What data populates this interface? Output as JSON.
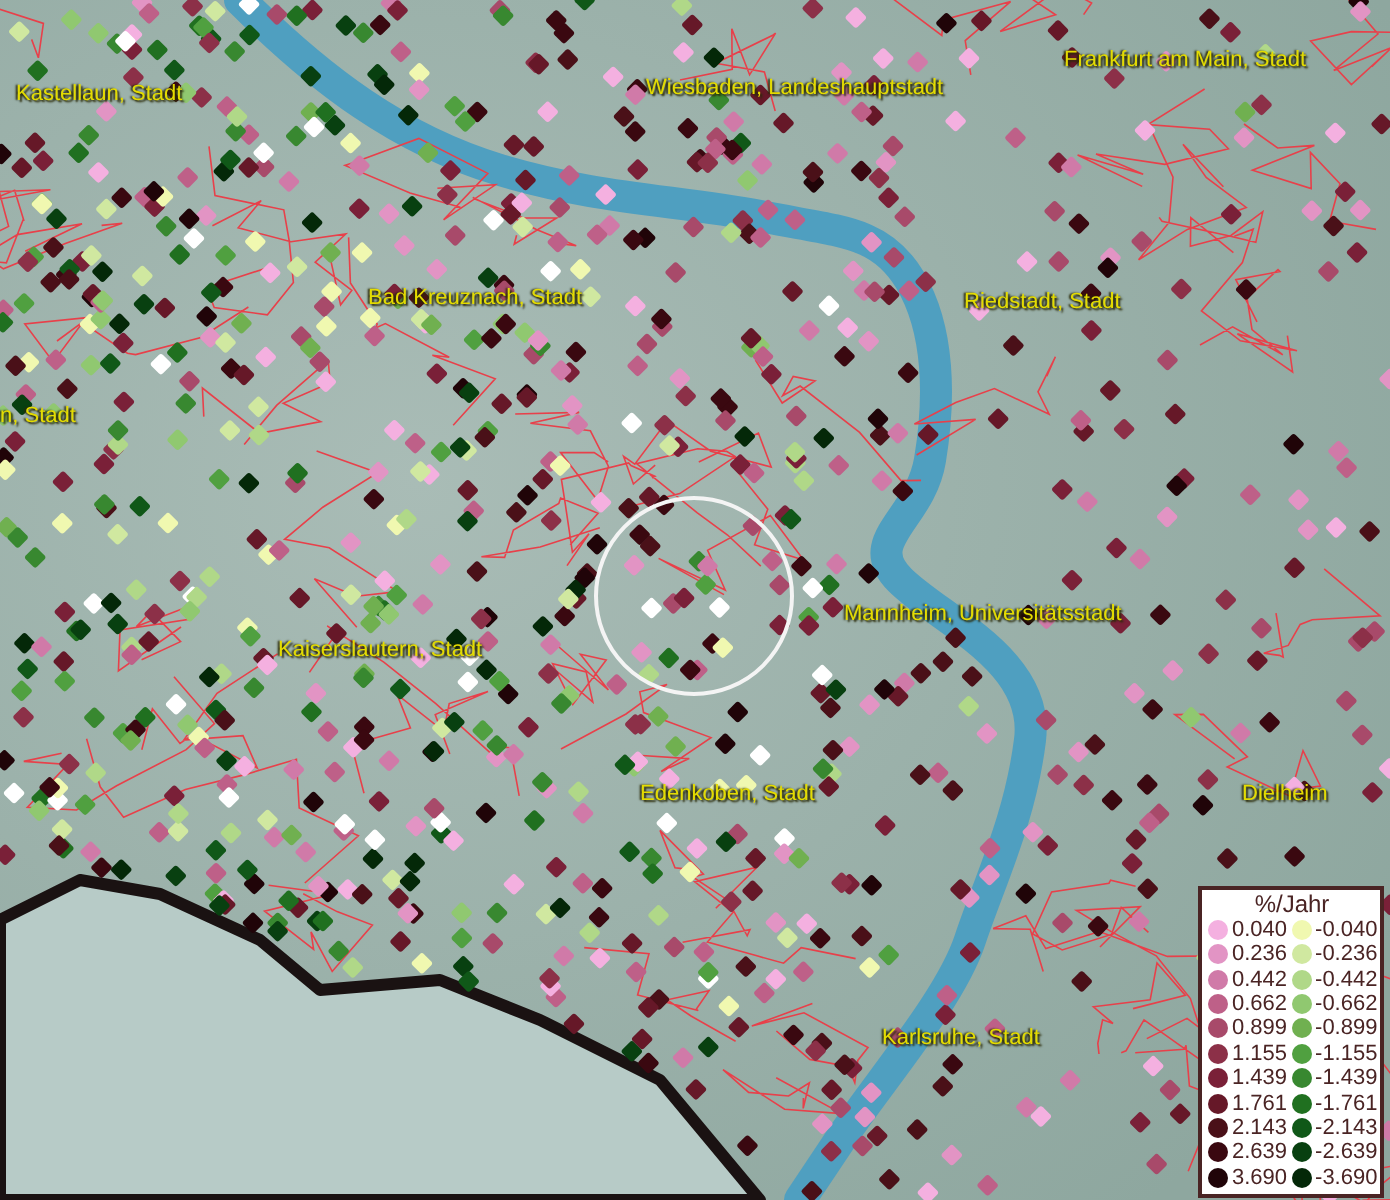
{
  "map": {
    "place_labels": [
      {
        "text": "Kastellaun, Stadt"
      },
      {
        "text": "Wiesbaden, Landeshauptstadt"
      },
      {
        "text": "Frankfurt am Main, Stadt"
      },
      {
        "text": "Bad Kreuznach, Stadt"
      },
      {
        "text": "Riedstadt, Stadt"
      },
      {
        "text": "n, Stadt"
      },
      {
        "text": "Kaiserslautern, Stadt"
      },
      {
        "text": "Mannheim, Universitätsstadt"
      },
      {
        "text": "Edenkoben, Stadt"
      },
      {
        "text": "Dielheim"
      },
      {
        "text": "Karlsruhe, Stadt"
      }
    ],
    "legend": {
      "title": "%/Jahr",
      "positive": [
        {
          "label": "0.040",
          "color": "#f4b0e0"
        },
        {
          "label": "0.236",
          "color": "#e294c4"
        },
        {
          "label": "0.442",
          "color": "#d07aa8"
        },
        {
          "label": "0.662",
          "color": "#be6088"
        },
        {
          "label": "0.899",
          "color": "#a84a6a"
        },
        {
          "label": "1.155",
          "color": "#8c3048"
        },
        {
          "label": "1.439",
          "color": "#7a2038"
        },
        {
          "label": "1.761",
          "color": "#661828"
        },
        {
          "label": "2.143",
          "color": "#4a1018"
        },
        {
          "label": "2.639",
          "color": "#3a0810"
        },
        {
          "label": "3.690",
          "color": "#200408"
        }
      ],
      "negative": [
        {
          "label": "-0.040",
          "color": "#f0f8b0"
        },
        {
          "label": "-0.236",
          "color": "#d0e8a0"
        },
        {
          "label": "-0.442",
          "color": "#b0d888"
        },
        {
          "label": "-0.662",
          "color": "#90c870"
        },
        {
          "label": "-0.899",
          "color": "#70b050"
        },
        {
          "label": "-1.155",
          "color": "#50a040"
        },
        {
          "label": "-1.439",
          "color": "#388830"
        },
        {
          "label": "-1.761",
          "color": "#207020"
        },
        {
          "label": "-2.143",
          "color": "#105818"
        },
        {
          "label": "-2.639",
          "color": "#084010"
        },
        {
          "label": "-3.690",
          "color": "#042808"
        }
      ]
    }
  }
}
